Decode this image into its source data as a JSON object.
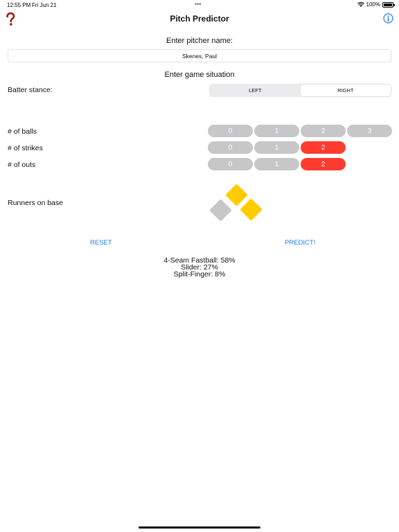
{
  "status_bar": {
    "time": "12:55 PM",
    "date": "Fri Jun 21",
    "battery": "100%",
    "icons": [
      "wifi-icon",
      "battery-icon"
    ]
  },
  "nav": {
    "title": "Pitch Predictor",
    "left_icon": "question-mark-icon",
    "right_icon": "info-icon"
  },
  "pitcher": {
    "prompt": "Enter pitcher name:",
    "value": "Skenes, Paul"
  },
  "game_situation": {
    "heading": "Enter game situation"
  },
  "stance": {
    "label": "Batter stance:",
    "options": [
      {
        "label": "LEFT",
        "selected": false
      },
      {
        "label": "RIGHT",
        "selected": true
      }
    ]
  },
  "balls": {
    "label": "# of balls",
    "options": [
      "0",
      "1",
      "2",
      "3"
    ],
    "selected": "2"
  },
  "strikes": {
    "label": "# of strikes",
    "options": [
      "0",
      "1",
      "2"
    ],
    "selected": "2"
  },
  "outs": {
    "label": "# of outs",
    "options": [
      "0",
      "1",
      "2"
    ],
    "selected": "2"
  },
  "runners": {
    "label": "Runners on base",
    "first": true,
    "second": true,
    "third": false,
    "active_color": "#ffcc00",
    "inactive_color": "#c7c7c9"
  },
  "actions": {
    "reset_label": "RESET",
    "predict_label": "PREDICT!"
  },
  "results": {
    "lines": [
      "4-Seam Fastball: 58%",
      "Slider: 27%",
      "Split-Finger: 8%"
    ]
  },
  "colors": {
    "accent": "#1e7df2",
    "selected_pill": "#ff3b30",
    "unselected_pill": "#c7c7c9"
  }
}
